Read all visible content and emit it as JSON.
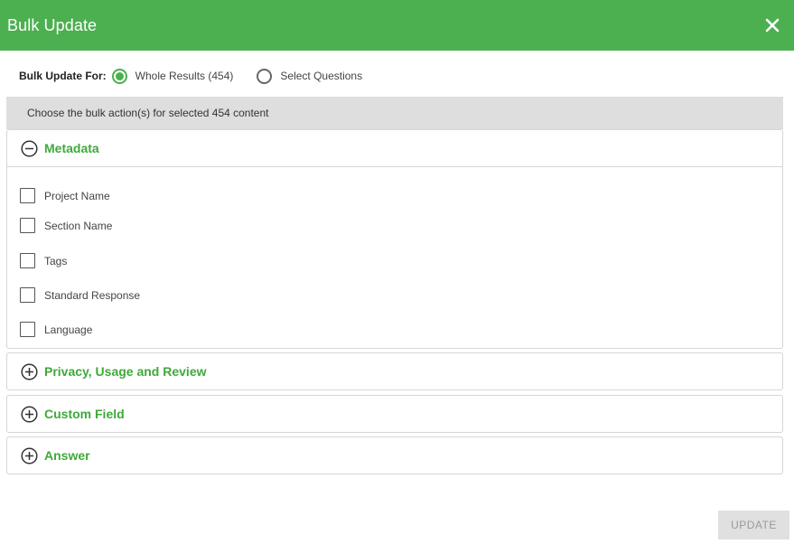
{
  "header": {
    "title": "Bulk Update"
  },
  "scope": {
    "label": "Bulk Update For:",
    "options": [
      {
        "label": "Whole Results (454)",
        "selected": true
      },
      {
        "label": "Select Questions",
        "selected": false
      }
    ]
  },
  "banner": {
    "text": "Choose the bulk action(s) for selected 454 content"
  },
  "sections": [
    {
      "title": "Metadata",
      "expanded": true,
      "items": [
        {
          "label": "Project Name",
          "checked": false
        },
        {
          "label": "Section Name",
          "checked": false
        },
        {
          "label": "Tags",
          "checked": false
        },
        {
          "label": "Standard Response",
          "checked": false
        },
        {
          "label": "Language",
          "checked": false
        }
      ]
    },
    {
      "title": "Privacy, Usage and Review",
      "expanded": false
    },
    {
      "title": "Custom Field",
      "expanded": false
    },
    {
      "title": "Answer",
      "expanded": false
    }
  ],
  "footer": {
    "update_label": "UPDATE",
    "update_enabled": false
  },
  "colors": {
    "accent": "#4caf50",
    "section_title": "#3fa93a",
    "banner_bg": "#dedede"
  },
  "icons": {
    "close": "close-icon",
    "collapse": "minus-circle-icon",
    "expand": "plus-circle-icon"
  }
}
